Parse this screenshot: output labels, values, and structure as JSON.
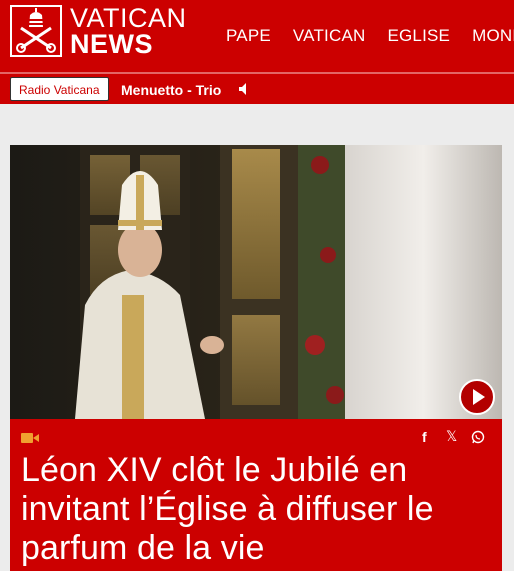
{
  "header": {
    "logo_line1": "VATICAN",
    "logo_line2": "NEWS",
    "nav": [
      "PAPE",
      "VATICAN",
      "EGLISE",
      "MONDE"
    ]
  },
  "radio": {
    "station_button": "Radio Vaticana",
    "now_playing": "Menuetto - Trio"
  },
  "article": {
    "headline": "Léon XIV clôt le Jubilé en invitant l’Église à diffuser le parfum de la vie",
    "media_type_icon": "video-camera-icon",
    "share_icons": [
      "facebook-icon",
      "x-icon",
      "whatsapp-icon"
    ]
  },
  "colors": {
    "brand_red": "#cc0000",
    "page_bg": "#ececec"
  }
}
